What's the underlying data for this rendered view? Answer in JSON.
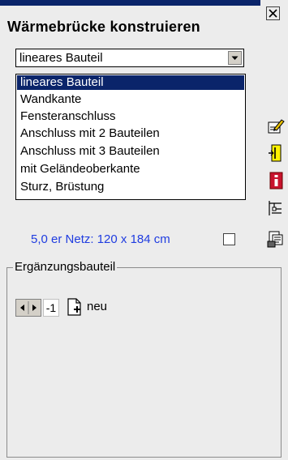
{
  "panel": {
    "title": "Wärmebrücke konstruieren",
    "close_icon": "close-icon",
    "accent_color": "#0a246a"
  },
  "combo": {
    "selected": "lineares Bauteil",
    "options": [
      "lineares Bauteil",
      "Wandkante",
      "Fensteranschluss",
      "Anschluss mit 2 Bauteilen",
      "Anschluss mit 3 Bauteilen",
      "mit Geländeoberkante",
      "Sturz, Brüstung"
    ]
  },
  "tools": [
    "pencil-edit-icon",
    "fit-icon",
    "info-icon",
    "tree-icon",
    "print-icon"
  ],
  "netz": {
    "text": "5,0 er Netz: 120 x 184 cm",
    "checked": false,
    "text_color": "#1f3ce0"
  },
  "group": {
    "label": "Ergänzungsbauteil",
    "index_value": "-1",
    "new_label": "neu"
  }
}
